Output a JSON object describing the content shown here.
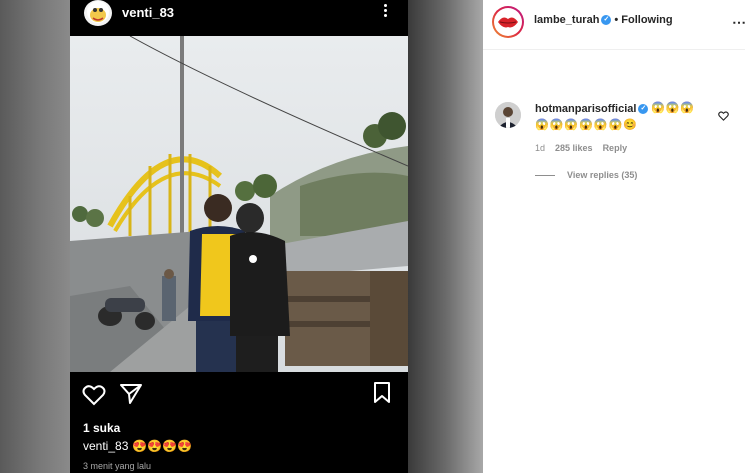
{
  "story": {
    "username": "venti_83",
    "likes": "1 suka",
    "caption_user": "venti_83",
    "caption_emojis": "😍😍😍😍",
    "time": "3 menit yang lalu",
    "icons": [
      "heart-icon",
      "send-icon",
      "bookmark-icon",
      "more-icon"
    ]
  },
  "post": {
    "username": "lambe_turah",
    "separator": "•",
    "follow_status": "Following"
  },
  "comment": {
    "username": "hotmanparisofficial",
    "emojis_line1": "😱😱😱",
    "emojis_line2": "😱😱😱😱😱😱😊",
    "age": "1d",
    "likes": "285 likes",
    "reply": "Reply",
    "view_replies": "View replies (35)"
  },
  "colors": {
    "verified": "#3897f0",
    "bridge": "#e6c21c",
    "shirt": "#f0c71c"
  }
}
